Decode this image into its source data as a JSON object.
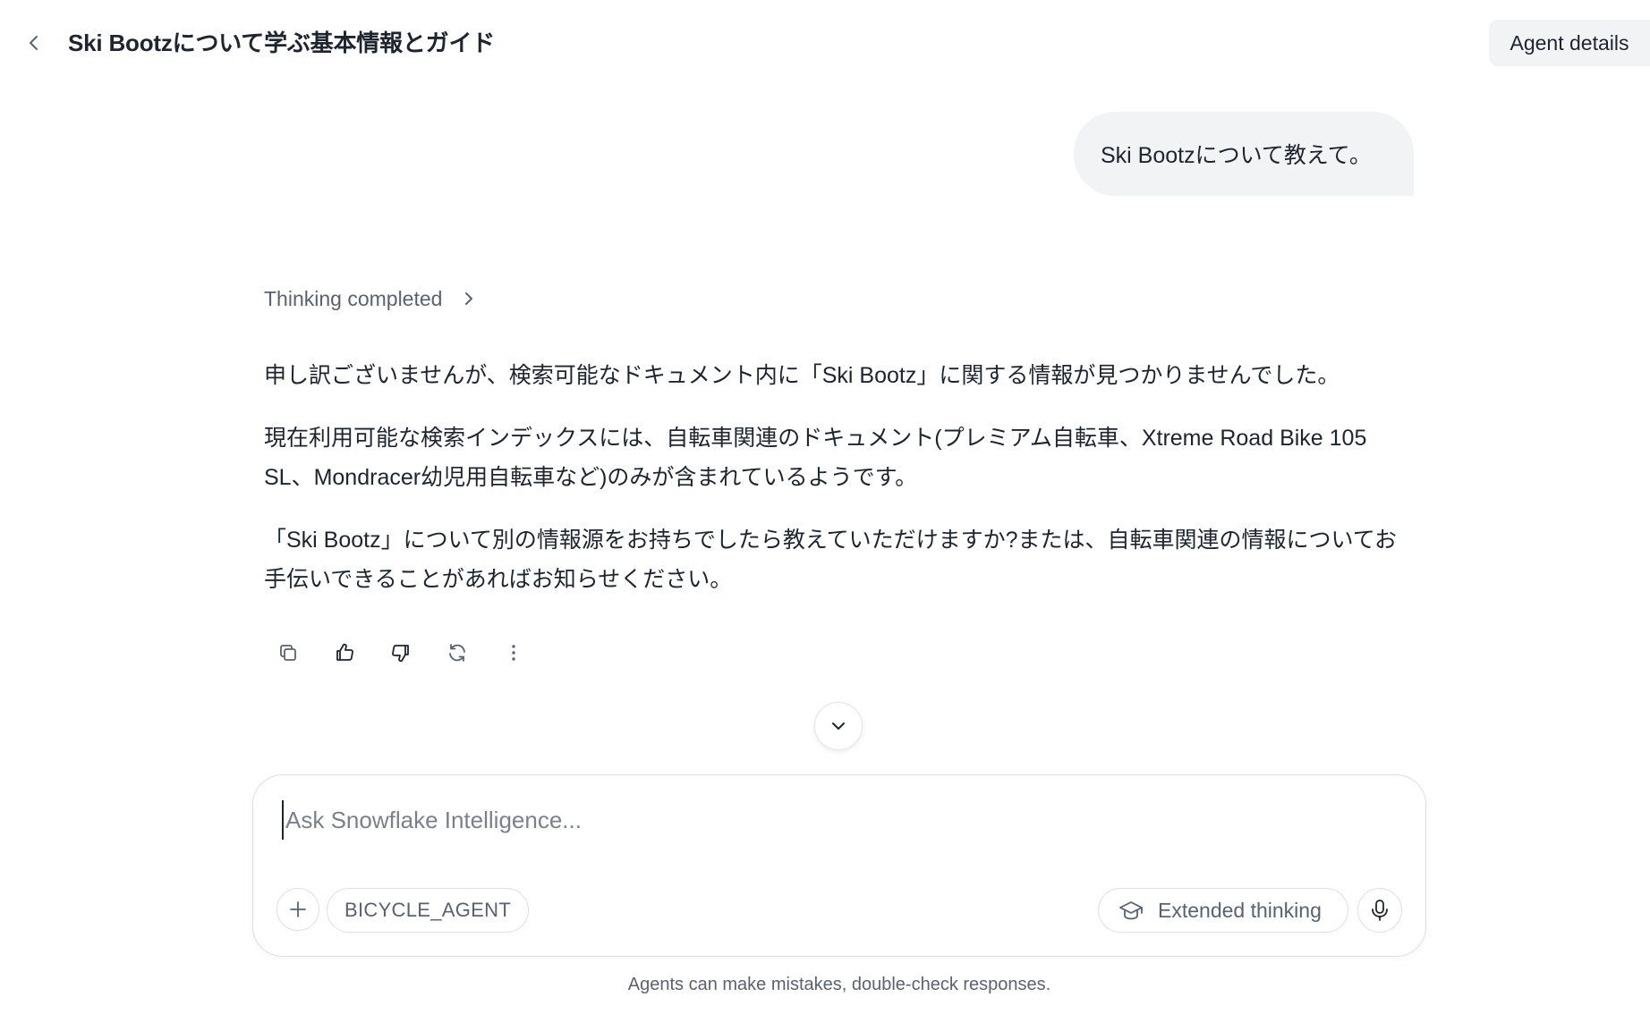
{
  "header": {
    "title": "Ski Bootzについて学ぶ基本情報とガイド",
    "agent_details_label": "Agent details"
  },
  "conversation": {
    "user_message": "Ski Bootzについて教えて。",
    "thinking_label": "Thinking completed",
    "response_paragraphs": [
      "申し訳ございませんが、検索可能なドキュメント内に「Ski Bootz」に関する情報が見つかりませんでした。",
      "現在利用可能な検索インデックスには、自転車関連のドキュメント(プレミアム自転車、Xtreme Road Bike 105 SL、Mondracer幼児用自転車など)のみが含まれているようです。",
      "「Ski Bootz」について別の情報源をお持ちでしたら教えていただけますか?または、自転車関連の情報についてお手伝いできることがあればお知らせください。"
    ],
    "actions": [
      "copy-icon",
      "thumbs-up-icon",
      "thumbs-down-icon",
      "regenerate-icon",
      "more-icon"
    ]
  },
  "composer": {
    "placeholder": "Ask Snowflake Intelligence...",
    "value": "",
    "agent_chip": "BICYCLE_AGENT",
    "extended_thinking_label": "Extended thinking"
  },
  "footer": {
    "disclaimer": "Agents can make mistakes, double-check responses."
  },
  "colors": {
    "text": "#1e252f",
    "muted": "#5a6272",
    "bubble_bg": "#f2f3f5",
    "border": "#dcdfe4"
  }
}
